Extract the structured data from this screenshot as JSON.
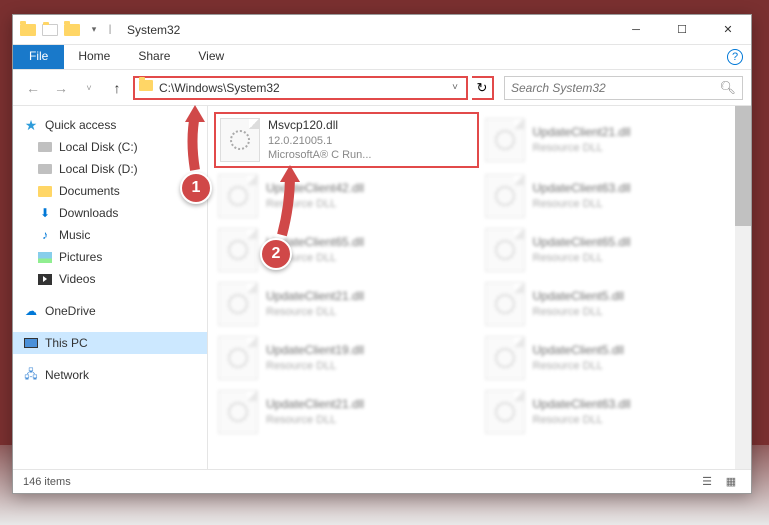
{
  "window": {
    "title": "System32"
  },
  "ribbon": {
    "file": "File",
    "tabs": [
      "Home",
      "Share",
      "View"
    ]
  },
  "nav": {
    "address": "C:\\Windows\\System32",
    "search_placeholder": "Search System32"
  },
  "sidebar": {
    "quick_access": "Quick access",
    "items": [
      "Local Disk (C:)",
      "Local Disk (D:)",
      "Documents",
      "Downloads",
      "Music",
      "Pictures",
      "Videos"
    ],
    "onedrive": "OneDrive",
    "this_pc": "This PC",
    "network": "Network"
  },
  "files": [
    {
      "name": "Msvcp120.dll",
      "line2": "12.0.21005.1",
      "line3": "MicrosoftA® C Run...",
      "highlighted": true
    },
    {
      "name": "UpdateClient21.dll",
      "line2": "Resource DLL",
      "line3": "",
      "highlighted": false
    },
    {
      "name": "UpdateClient42.dll",
      "line2": "Resource DLL",
      "line3": "",
      "highlighted": false
    },
    {
      "name": "UpdateClient63.dll",
      "line2": "Resource DLL",
      "line3": "",
      "highlighted": false
    },
    {
      "name": "UpdateClient65.dll",
      "line2": "Resource DLL",
      "line3": "",
      "highlighted": false
    },
    {
      "name": "UpdateClient65.dll",
      "line2": "Resource DLL",
      "line3": "",
      "highlighted": false
    },
    {
      "name": "UpdateClient21.dll",
      "line2": "Resource DLL",
      "line3": "",
      "highlighted": false
    },
    {
      "name": "UpdateClient5.dll",
      "line2": "Resource DLL",
      "line3": "",
      "highlighted": false
    },
    {
      "name": "UpdateClient19.dll",
      "line2": "Resource DLL",
      "line3": "",
      "highlighted": false
    },
    {
      "name": "UpdateClient5.dll",
      "line2": "Resource DLL",
      "line3": "",
      "highlighted": false
    },
    {
      "name": "UpdateClient21.dll",
      "line2": "Resource DLL",
      "line3": "",
      "highlighted": false
    },
    {
      "name": "UpdateClient63.dll",
      "line2": "Resource DLL",
      "line3": "",
      "highlighted": false
    }
  ],
  "status": {
    "count": "146 items"
  },
  "callouts": {
    "one": "1",
    "two": "2"
  }
}
